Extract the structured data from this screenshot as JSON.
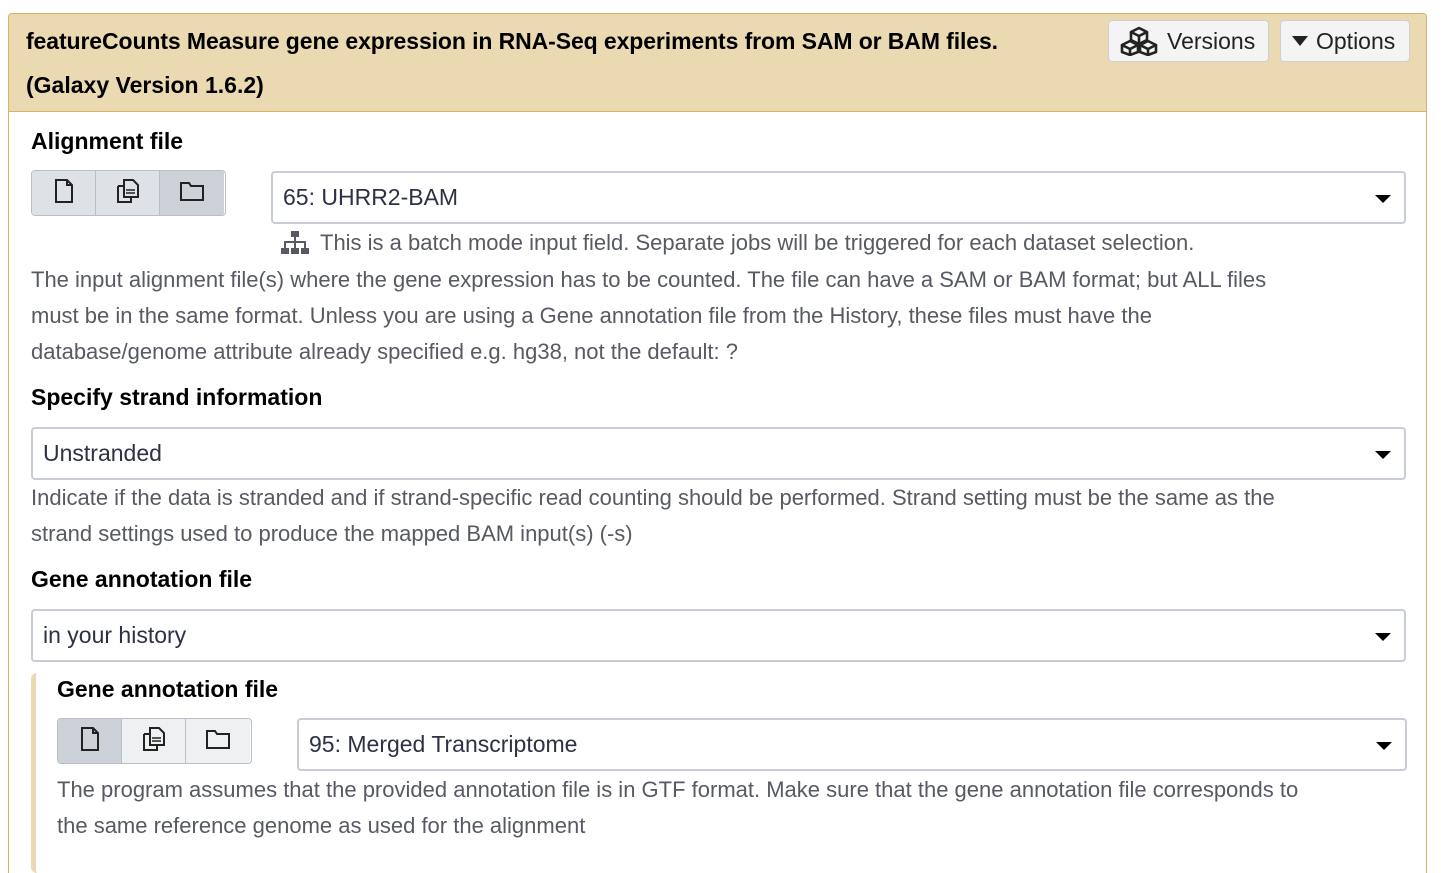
{
  "header": {
    "title": "featureCounts Measure gene expression in RNA-Seq experiments from SAM or BAM files.",
    "version": "(Galaxy Version 1.6.2)",
    "versions_label": "Versions",
    "options_label": "Options"
  },
  "alignment": {
    "label": "Alignment file",
    "selected": "65: UHRR2-BAM",
    "batch_note": "This is a batch mode input field. Separate jobs will be triggered for each dataset selection.",
    "help_lines": [
      "The input alignment file(s) where the gene expression has to be counted. The file can have a SAM or BAM format; but ALL files",
      "must be in the same format. Unless you are using a Gene annotation file from the History, these files must have the",
      "database/genome attribute already specified e.g. hg38, not the default: ?"
    ]
  },
  "strand": {
    "label": "Specify strand information",
    "selected": "Unstranded",
    "help_lines": [
      "Indicate if the data is stranded and if strand-specific read counting should be performed. Strand setting must be the same as the",
      "strand settings used to produce the mapped BAM input(s) (-s)"
    ]
  },
  "annotation_source": {
    "label": "Gene annotation file",
    "selected": "in your history"
  },
  "annotation_file": {
    "label": "Gene annotation file",
    "selected": "95: Merged Transcriptome",
    "help_lines": [
      "The program assumes that the provided annotation file is in GTF format. Make sure that the gene annotation file corresponds to",
      "the same reference genome as used for the alignment"
    ]
  }
}
